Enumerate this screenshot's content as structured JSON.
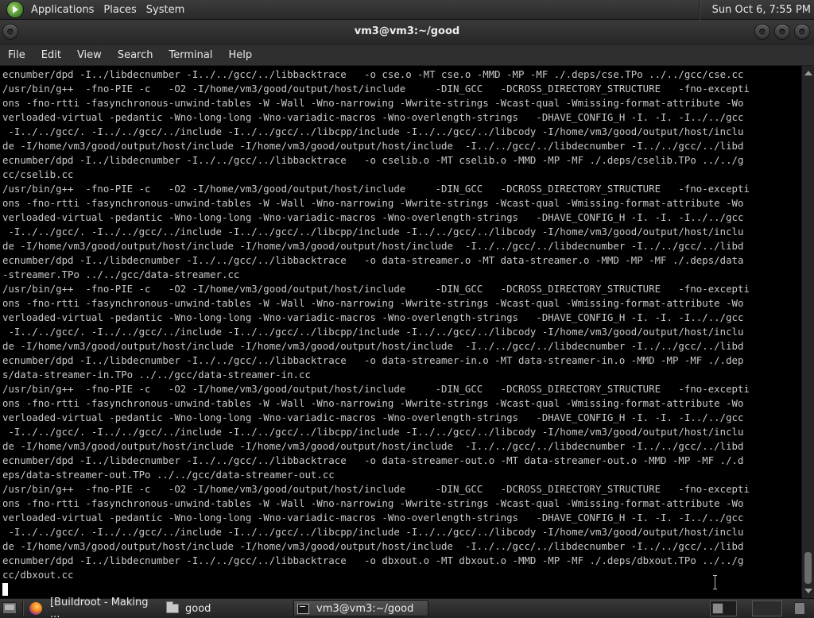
{
  "top_panel": {
    "menus": [
      "Applications",
      "Places",
      "System"
    ],
    "clock": "Sun Oct  6,  7:55 PM"
  },
  "window": {
    "title": "vm3@vm3:~/good"
  },
  "menubar": {
    "items": [
      "File",
      "Edit",
      "View",
      "Search",
      "Terminal",
      "Help"
    ]
  },
  "terminal": {
    "lines": [
      "ecnumber/dpd -I../libdecnumber -I../../gcc/../libbacktrace   -o cse.o -MT cse.o -MMD -MP -MF ./.deps/cse.TPo ../../gcc/cse.cc",
      "/usr/bin/g++  -fno-PIE -c   -O2 -I/home/vm3/good/output/host/include     -DIN_GCC   -DCROSS_DIRECTORY_STRUCTURE   -fno-excepti",
      "ons -fno-rtti -fasynchronous-unwind-tables -W -Wall -Wno-narrowing -Wwrite-strings -Wcast-qual -Wmissing-format-attribute -Wo",
      "verloaded-virtual -pedantic -Wno-long-long -Wno-variadic-macros -Wno-overlength-strings   -DHAVE_CONFIG_H -I. -I. -I../../gcc",
      " -I../../gcc/. -I../../gcc/../include -I../../gcc/../libcpp/include -I../../gcc/../libcody -I/home/vm3/good/output/host/inclu",
      "de -I/home/vm3/good/output/host/include -I/home/vm3/good/output/host/include  -I../../gcc/../libdecnumber -I../../gcc/../libd",
      "ecnumber/dpd -I../libdecnumber -I../../gcc/../libbacktrace   -o cselib.o -MT cselib.o -MMD -MP -MF ./.deps/cselib.TPo ../../g",
      "cc/cselib.cc",
      "/usr/bin/g++  -fno-PIE -c   -O2 -I/home/vm3/good/output/host/include     -DIN_GCC   -DCROSS_DIRECTORY_STRUCTURE   -fno-excepti",
      "ons -fno-rtti -fasynchronous-unwind-tables -W -Wall -Wno-narrowing -Wwrite-strings -Wcast-qual -Wmissing-format-attribute -Wo",
      "verloaded-virtual -pedantic -Wno-long-long -Wno-variadic-macros -Wno-overlength-strings   -DHAVE_CONFIG_H -I. -I. -I../../gcc",
      " -I../../gcc/. -I../../gcc/../include -I../../gcc/../libcpp/include -I../../gcc/../libcody -I/home/vm3/good/output/host/inclu",
      "de -I/home/vm3/good/output/host/include -I/home/vm3/good/output/host/include  -I../../gcc/../libdecnumber -I../../gcc/../libd",
      "ecnumber/dpd -I../libdecnumber -I../../gcc/../libbacktrace   -o data-streamer.o -MT data-streamer.o -MMD -MP -MF ./.deps/data",
      "-streamer.TPo ../../gcc/data-streamer.cc",
      "/usr/bin/g++  -fno-PIE -c   -O2 -I/home/vm3/good/output/host/include     -DIN_GCC   -DCROSS_DIRECTORY_STRUCTURE   -fno-excepti",
      "ons -fno-rtti -fasynchronous-unwind-tables -W -Wall -Wno-narrowing -Wwrite-strings -Wcast-qual -Wmissing-format-attribute -Wo",
      "verloaded-virtual -pedantic -Wno-long-long -Wno-variadic-macros -Wno-overlength-strings   -DHAVE_CONFIG_H -I. -I. -I../../gcc",
      " -I../../gcc/. -I../../gcc/../include -I../../gcc/../libcpp/include -I../../gcc/../libcody -I/home/vm3/good/output/host/inclu",
      "de -I/home/vm3/good/output/host/include -I/home/vm3/good/output/host/include  -I../../gcc/../libdecnumber -I../../gcc/../libd",
      "ecnumber/dpd -I../libdecnumber -I../../gcc/../libbacktrace   -o data-streamer-in.o -MT data-streamer-in.o -MMD -MP -MF ./.dep",
      "s/data-streamer-in.TPo ../../gcc/data-streamer-in.cc",
      "/usr/bin/g++  -fno-PIE -c   -O2 -I/home/vm3/good/output/host/include     -DIN_GCC   -DCROSS_DIRECTORY_STRUCTURE   -fno-excepti",
      "ons -fno-rtti -fasynchronous-unwind-tables -W -Wall -Wno-narrowing -Wwrite-strings -Wcast-qual -Wmissing-format-attribute -Wo",
      "verloaded-virtual -pedantic -Wno-long-long -Wno-variadic-macros -Wno-overlength-strings   -DHAVE_CONFIG_H -I. -I. -I../../gcc",
      " -I../../gcc/. -I../../gcc/../include -I../../gcc/../libcpp/include -I../../gcc/../libcody -I/home/vm3/good/output/host/inclu",
      "de -I/home/vm3/good/output/host/include -I/home/vm3/good/output/host/include  -I../../gcc/../libdecnumber -I../../gcc/../libd",
      "ecnumber/dpd -I../libdecnumber -I../../gcc/../libbacktrace   -o data-streamer-out.o -MT data-streamer-out.o -MMD -MP -MF ./.d",
      "eps/data-streamer-out.TPo ../../gcc/data-streamer-out.cc",
      "/usr/bin/g++  -fno-PIE -c   -O2 -I/home/vm3/good/output/host/include     -DIN_GCC   -DCROSS_DIRECTORY_STRUCTURE   -fno-excepti",
      "ons -fno-rtti -fasynchronous-unwind-tables -W -Wall -Wno-narrowing -Wwrite-strings -Wcast-qual -Wmissing-format-attribute -Wo",
      "verloaded-virtual -pedantic -Wno-long-long -Wno-variadic-macros -Wno-overlength-strings   -DHAVE_CONFIG_H -I. -I. -I../../gcc",
      " -I../../gcc/. -I../../gcc/../include -I../../gcc/../libcpp/include -I../../gcc/../libcody -I/home/vm3/good/output/host/inclu",
      "de -I/home/vm3/good/output/host/include -I/home/vm3/good/output/host/include  -I../../gcc/../libdecnumber -I../../gcc/../libd",
      "ecnumber/dpd -I../libdecnumber -I../../gcc/../libbacktrace   -o dbxout.o -MT dbxout.o -MMD -MP -MF ./.deps/dbxout.TPo ../../g",
      "cc/dbxout.cc"
    ]
  },
  "taskbar": {
    "tasks": [
      {
        "label": "[Buildroot - Making ...",
        "icon": "firefox-icon"
      },
      {
        "label": "good",
        "icon": "folder-icon"
      },
      {
        "label": "vm3@vm3:~/good",
        "icon": "terminal-icon"
      }
    ]
  }
}
